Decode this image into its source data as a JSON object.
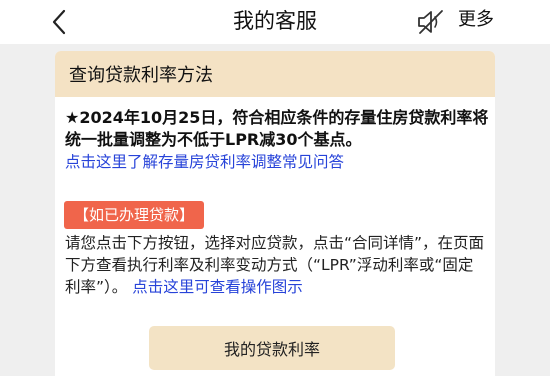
{
  "header": {
    "title": "我的客服",
    "more_label": "更多",
    "back_icon": "chevron-left-icon",
    "mute_icon": "speaker-muted-icon"
  },
  "card": {
    "header_title": "查询贷款利率方法",
    "notice": "★2024年10月25日，符合相应条件的存量住房贷款利率将统一批量调整为不低于LPR减30个基点。",
    "faq_link": "点击这里了解存量房贷利率调整常见问答",
    "tag_label": "【如已办理贷款】",
    "instruction_text": "请您点击下方按钮，选择对应贷款，点击“合同详情”，在页面下方查看执行利率及利率变动方式（“LPR”浮动利率或“固定利率”）。",
    "instruction_link": "点击这里可查看操作图示",
    "button_label": "我的贷款利率"
  },
  "colors": {
    "accent_link": "#2743d9",
    "tag_bg": "#f0654b",
    "header_bg": "#f4e2c4"
  }
}
